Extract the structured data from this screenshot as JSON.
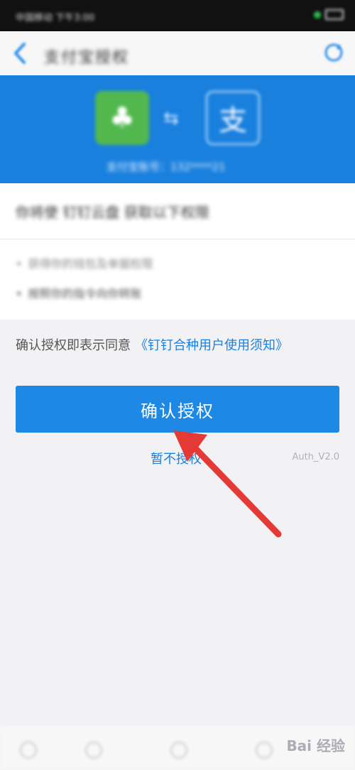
{
  "status_bar": {
    "left_text": "中国移动 下午3:00",
    "right_text": ""
  },
  "nav": {
    "title": "支付宝授权"
  },
  "banner": {
    "caption": "支付宝账号：132****21"
  },
  "card": {
    "headline": "你将使 钉钉云盘 获取以下权限",
    "permissions": [
      "获得你的钱包及单据权限",
      "按照你的指令向你转账"
    ]
  },
  "agreement": {
    "prefix": "确认授权即表示同意",
    "link": "《钉钉合种用户使用须知》"
  },
  "confirm_button": {
    "label": "确认授权"
  },
  "skip_link": {
    "label": "暂不授权"
  },
  "version": "Auth_V2.0",
  "watermark": "Bai 经验",
  "colors": {
    "accent": "#1e88e5",
    "banner": "#1a80de",
    "arrow": "#e53935"
  }
}
